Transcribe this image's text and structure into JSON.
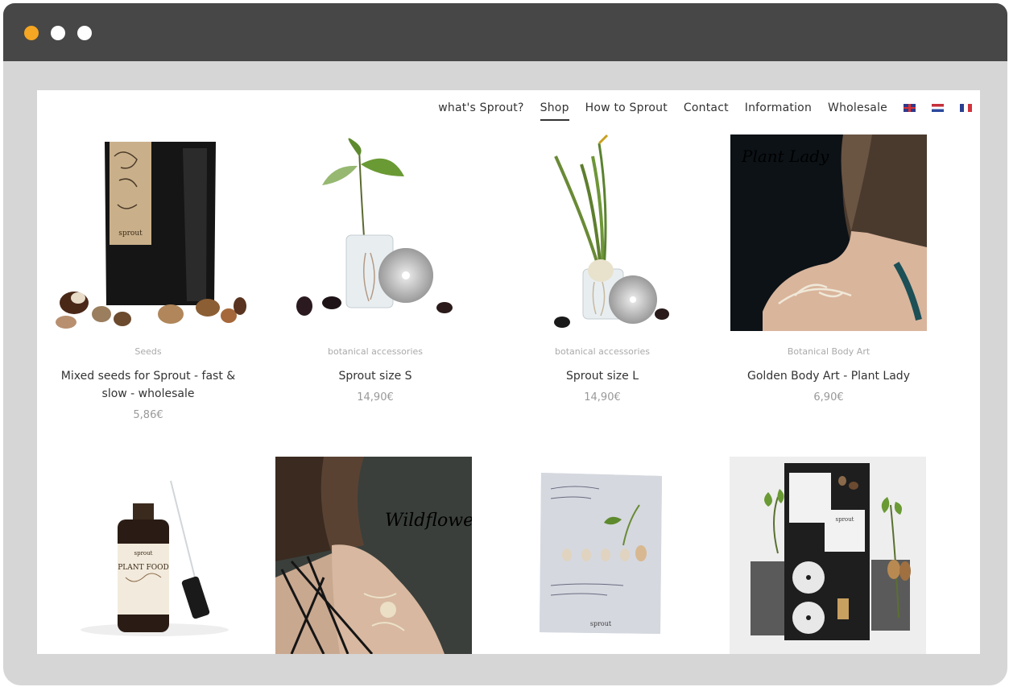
{
  "window": {
    "dots": [
      "#f5a623",
      "#ffffff",
      "#ffffff"
    ]
  },
  "nav": {
    "items": [
      {
        "label": "what's Sprout?"
      },
      {
        "label": "Shop",
        "active": true
      },
      {
        "label": "How to Sprout"
      },
      {
        "label": "Contact"
      },
      {
        "label": "Information"
      },
      {
        "label": "Wholesale"
      }
    ],
    "flags": [
      "uk-flag",
      "nl-flag",
      "fr-flag"
    ]
  },
  "products": [
    {
      "category": "Seeds",
      "name": "Mixed seeds for Sprout - fast & slow - wholesale",
      "price": "5,86€",
      "bag_label": "sprout"
    },
    {
      "category": "botanical accessories",
      "name": "Sprout size S",
      "price": "14,90€"
    },
    {
      "category": "botanical accessories",
      "name": "Sprout size L",
      "price": "14,90€"
    },
    {
      "category": "Botanical Body Art",
      "name": "Golden Body Art - Plant Lady",
      "price": "6,90€",
      "image_title": "Plant Lady"
    }
  ],
  "products_row2": [
    {
      "image": "plant-food-bottle",
      "bottle_label": "PLANT FOOD",
      "bottle_brand": "sprout"
    },
    {
      "image": "wildflower-tattoo",
      "image_title": "Wildflower"
    },
    {
      "image": "sprout-book",
      "brand": "sprout"
    },
    {
      "image": "sprout-gift-box",
      "brand": "sprout"
    }
  ]
}
